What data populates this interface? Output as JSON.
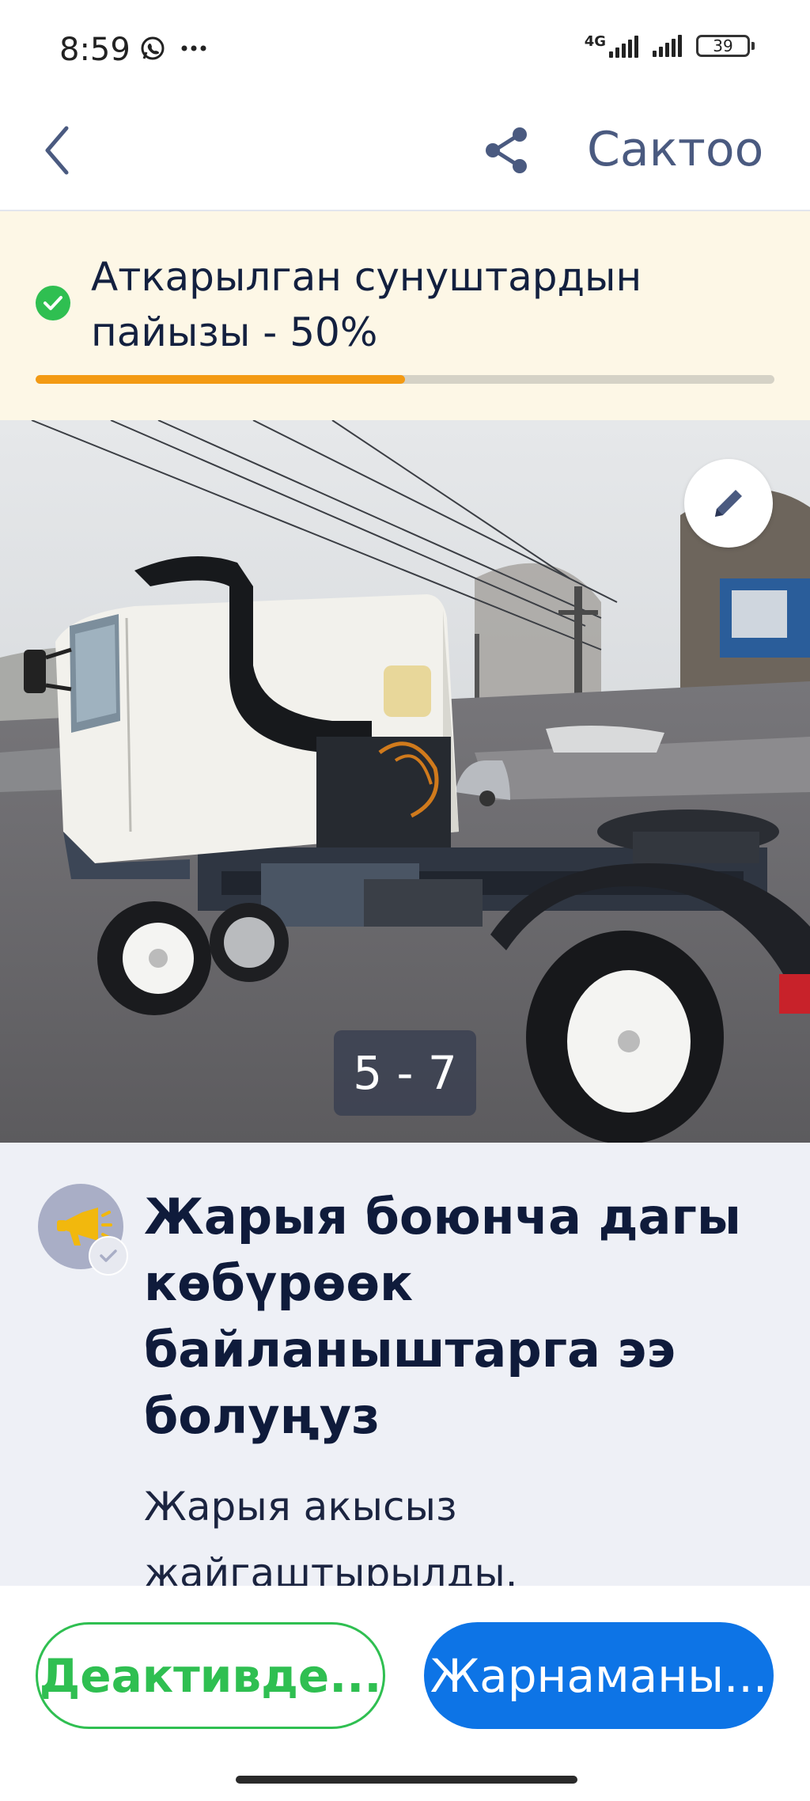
{
  "status_bar": {
    "time": "8:59",
    "network": "4G",
    "battery": "39"
  },
  "header": {
    "save_label": "Сактоо"
  },
  "progress": {
    "text": "Аткарылган сунуштардын пайызы - 50%",
    "value_percent": 50,
    "accent": "#f39a13",
    "check_color": "#2fbf51"
  },
  "gallery": {
    "counter": "5 - 7"
  },
  "promo": {
    "title": "Жарыя боюнча дагы көбүрөөк байланыштарга ээ болуңуз",
    "subtitle": "Жарыя акысыз жайгаштырылды."
  },
  "actions": {
    "deactivate_label": "Деактивде...",
    "advertise_label": "Жарнаманы..."
  },
  "colors": {
    "primary": "#0d74e6",
    "green": "#2fbf51",
    "text": "#13203f"
  }
}
